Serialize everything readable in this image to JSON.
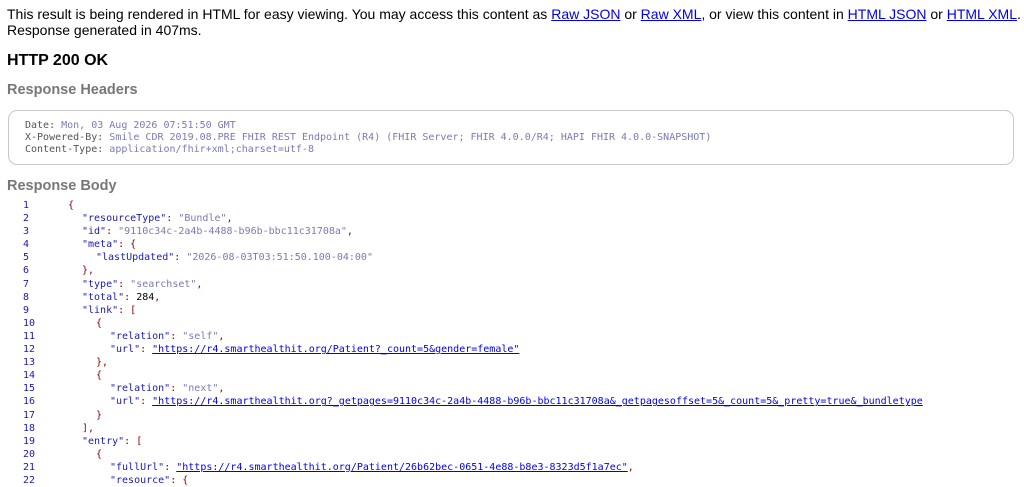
{
  "intro": {
    "text_1": "This result is being rendered in HTML for easy viewing. You may access this content as ",
    "raw_json_link": "Raw JSON",
    "text_2": " or ",
    "raw_xml_link": "Raw XML",
    "text_3": ", or view this content in ",
    "html_json_link": "HTML JSON",
    "text_4": " or ",
    "html_xml_link": "HTML XML",
    "text_5": ". Response generated in 407ms."
  },
  "status": "HTTP 200 OK",
  "response_headers": {
    "title": "Response Headers",
    "lines": [
      {
        "name": "Date: ",
        "value": "Mon, 03 Aug 2026 07:51:50 GMT"
      },
      {
        "name": "X-Powered-By: ",
        "value": "Smile CDR 2019.08.PRE FHIR REST Endpoint (R4) (FHIR Server; FHIR 4.0.0/R4; HAPI FHIR 4.0.0-SNAPSHOT)"
      },
      {
        "name": "Content-Type: ",
        "value": "application/fhir+xml;charset=utf-8"
      }
    ]
  },
  "response_body": {
    "title": "Response Body",
    "lines": [
      {
        "n": "1",
        "indent": 0,
        "tokens": [
          [
            "punct",
            "{"
          ]
        ]
      },
      {
        "n": "2",
        "indent": 1,
        "tokens": [
          [
            "key",
            "\"resourceType\""
          ],
          [
            "punct",
            ": "
          ],
          [
            "str",
            "\"Bundle\""
          ],
          [
            "punct",
            ","
          ]
        ]
      },
      {
        "n": "3",
        "indent": 1,
        "tokens": [
          [
            "key",
            "\"id\""
          ],
          [
            "punct",
            ": "
          ],
          [
            "str",
            "\"9110c34c-2a4b-4488-b96b-bbc11c31708a\""
          ],
          [
            "punct",
            ","
          ]
        ]
      },
      {
        "n": "4",
        "indent": 1,
        "tokens": [
          [
            "key",
            "\"meta\""
          ],
          [
            "punct",
            ": {"
          ]
        ]
      },
      {
        "n": "5",
        "indent": 2,
        "tokens": [
          [
            "key",
            "\"lastUpdated\""
          ],
          [
            "punct",
            ": "
          ],
          [
            "str",
            "\"2026-08-03T03:51:50.100-04:00\""
          ]
        ]
      },
      {
        "n": "6",
        "indent": 1,
        "tokens": [
          [
            "punct",
            "},"
          ]
        ]
      },
      {
        "n": "7",
        "indent": 1,
        "tokens": [
          [
            "key",
            "\"type\""
          ],
          [
            "punct",
            ": "
          ],
          [
            "str",
            "\"searchset\""
          ],
          [
            "punct",
            ","
          ]
        ]
      },
      {
        "n": "8",
        "indent": 1,
        "tokens": [
          [
            "key",
            "\"total\""
          ],
          [
            "punct",
            ": "
          ],
          [
            "num",
            "284"
          ],
          [
            "punct",
            ","
          ]
        ]
      },
      {
        "n": "9",
        "indent": 1,
        "tokens": [
          [
            "key",
            "\"link\""
          ],
          [
            "punct",
            ": ["
          ]
        ]
      },
      {
        "n": "10",
        "indent": 2,
        "tokens": [
          [
            "punct",
            "{"
          ]
        ]
      },
      {
        "n": "11",
        "indent": 3,
        "tokens": [
          [
            "key",
            "\"relation\""
          ],
          [
            "punct",
            ": "
          ],
          [
            "str",
            "\"self\""
          ],
          [
            "punct",
            ","
          ]
        ]
      },
      {
        "n": "12",
        "indent": 3,
        "tokens": [
          [
            "key",
            "\"url\""
          ],
          [
            "punct",
            ": "
          ],
          [
            "url",
            "\"https://r4.smarthealthit.org/Patient?_count=5&gender=female\""
          ]
        ]
      },
      {
        "n": "13",
        "indent": 2,
        "tokens": [
          [
            "punct",
            "},"
          ]
        ]
      },
      {
        "n": "14",
        "indent": 2,
        "tokens": [
          [
            "punct",
            "{"
          ]
        ]
      },
      {
        "n": "15",
        "indent": 3,
        "tokens": [
          [
            "key",
            "\"relation\""
          ],
          [
            "punct",
            ": "
          ],
          [
            "str",
            "\"next\""
          ],
          [
            "punct",
            ","
          ]
        ]
      },
      {
        "n": "16",
        "indent": 3,
        "tokens": [
          [
            "key",
            "\"url\""
          ],
          [
            "punct",
            ": "
          ],
          [
            "url",
            "\"https://r4.smarthealthit.org?_getpages=9110c34c-2a4b-4488-b96b-bbc11c31708a&_getpagesoffset=5&_count=5&_pretty=true&_bundletype"
          ]
        ]
      },
      {
        "n": "17",
        "indent": 2,
        "tokens": [
          [
            "punct",
            "}"
          ]
        ]
      },
      {
        "n": "18",
        "indent": 1,
        "tokens": [
          [
            "punct",
            "],"
          ]
        ]
      },
      {
        "n": "19",
        "indent": 1,
        "tokens": [
          [
            "key",
            "\"entry\""
          ],
          [
            "punct",
            ": ["
          ]
        ]
      },
      {
        "n": "20",
        "indent": 2,
        "tokens": [
          [
            "punct",
            "{"
          ]
        ]
      },
      {
        "n": "21",
        "indent": 3,
        "tokens": [
          [
            "key",
            "\"fullUrl\""
          ],
          [
            "punct",
            ": "
          ],
          [
            "url",
            "\"https://r4.smarthealthit.org/Patient/26b62bec-0651-4e88-b8e3-8323d5f1a7ec\""
          ],
          [
            "punct",
            ","
          ]
        ]
      },
      {
        "n": "22",
        "indent": 3,
        "tokens": [
          [
            "key",
            "\"resource\""
          ],
          [
            "punct",
            ": {"
          ]
        ]
      }
    ]
  }
}
